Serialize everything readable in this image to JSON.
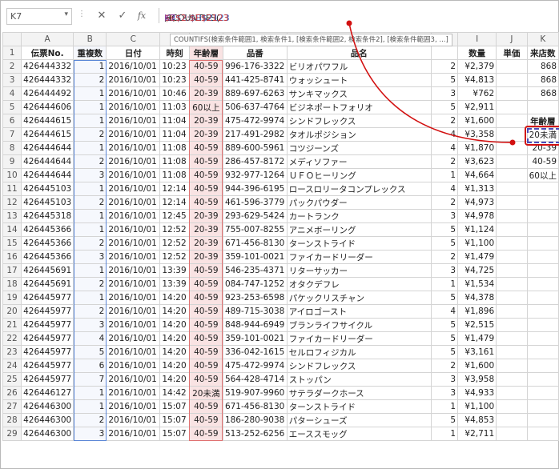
{
  "formula_bar": {
    "name_box": "K7",
    "formula_prefix": "=COUNTIFS(",
    "formula_arg1": "$B$2:$B$2123",
    "formula_arg2": ",1,",
    "formula_arg3": "$E$2:$E$2123",
    "formula_arg4": ",",
    "formula_arg5": "K7",
    "tooltip": "COUNTIFS(検索条件範囲1, 検索条件1, [検索条件範囲2, 検索条件2], [検索条件範囲3, ...]"
  },
  "columns": [
    "A",
    "B",
    "C",
    "D",
    "E",
    "F",
    "G",
    "H",
    "I",
    "J",
    "K"
  ],
  "headers": [
    "伝票No.",
    "重複数",
    "日付",
    "時刻",
    "年齢層",
    "品番",
    "品名",
    "",
    "数量",
    "単価",
    "来店数"
  ],
  "rows": [
    [
      "426444332",
      "1",
      "2016/10/01",
      "10:23",
      "40-59",
      "996-176-3322",
      "ビリオパワフル",
      "2",
      "¥2,379",
      "",
      "868"
    ],
    [
      "426444332",
      "2",
      "2016/10/01",
      "10:23",
      "40-59",
      "441-425-8741",
      "ウォッシュート",
      "5",
      "¥4,813",
      "",
      "868"
    ],
    [
      "426444492",
      "1",
      "2016/10/01",
      "10:46",
      "20-39",
      "889-697-6263",
      "サンキマックス",
      "3",
      "¥762",
      "",
      "868"
    ],
    [
      "426444606",
      "1",
      "2016/10/01",
      "11:03",
      "60以上",
      "506-637-4764",
      "ビジネポートフォリオ",
      "5",
      "¥2,911",
      "",
      ""
    ],
    [
      "426444615",
      "1",
      "2016/10/01",
      "11:04",
      "20-39",
      "475-472-9974",
      "シンドフレックス",
      "2",
      "¥1,600",
      "",
      "年齢層"
    ],
    [
      "426444615",
      "2",
      "2016/10/01",
      "11:04",
      "20-39",
      "217-491-2982",
      "タオルポジション",
      "4",
      "¥3,358",
      "",
      "20未満"
    ],
    [
      "426444644",
      "1",
      "2016/10/01",
      "11:08",
      "40-59",
      "889-600-5961",
      "コツジーンズ",
      "4",
      "¥1,870",
      "",
      "20-39"
    ],
    [
      "426444644",
      "2",
      "2016/10/01",
      "11:08",
      "40-59",
      "286-457-8172",
      "メディソファー",
      "2",
      "¥3,623",
      "",
      "40-59"
    ],
    [
      "426444644",
      "3",
      "2016/10/01",
      "11:08",
      "40-59",
      "932-977-1264",
      "ＵＦＯヒーリング",
      "1",
      "¥4,664",
      "",
      "60以上"
    ],
    [
      "426445103",
      "1",
      "2016/10/01",
      "12:14",
      "40-59",
      "944-396-6195",
      "ロースロリータコンプレックス",
      "4",
      "¥1,313",
      "",
      ""
    ],
    [
      "426445103",
      "2",
      "2016/10/01",
      "12:14",
      "40-59",
      "461-596-3779",
      "パックパウダー",
      "2",
      "¥4,973",
      "",
      ""
    ],
    [
      "426445318",
      "1",
      "2016/10/01",
      "12:45",
      "20-39",
      "293-629-5424",
      "カートランク",
      "3",
      "¥4,978",
      "",
      ""
    ],
    [
      "426445366",
      "1",
      "2016/10/01",
      "12:52",
      "20-39",
      "755-007-8255",
      "アニメボーリング",
      "5",
      "¥1,124",
      "",
      ""
    ],
    [
      "426445366",
      "2",
      "2016/10/01",
      "12:52",
      "20-39",
      "671-456-8130",
      "ターンストライド",
      "5",
      "¥1,100",
      "",
      ""
    ],
    [
      "426445366",
      "3",
      "2016/10/01",
      "12:52",
      "20-39",
      "359-101-0021",
      "ファイカードリーダー",
      "2",
      "¥1,479",
      "",
      ""
    ],
    [
      "426445691",
      "1",
      "2016/10/01",
      "13:39",
      "40-59",
      "546-235-4371",
      "リターサッカー",
      "3",
      "¥4,725",
      "",
      ""
    ],
    [
      "426445691",
      "2",
      "2016/10/01",
      "13:39",
      "40-59",
      "084-747-1252",
      "オタクデフレ",
      "1",
      "¥1,534",
      "",
      ""
    ],
    [
      "426445977",
      "1",
      "2016/10/01",
      "14:20",
      "40-59",
      "923-253-6598",
      "パケックリスチャン",
      "5",
      "¥4,378",
      "",
      ""
    ],
    [
      "426445977",
      "2",
      "2016/10/01",
      "14:20",
      "40-59",
      "489-715-3038",
      "アイロゴースト",
      "4",
      "¥1,896",
      "",
      ""
    ],
    [
      "426445977",
      "3",
      "2016/10/01",
      "14:20",
      "40-59",
      "848-944-6949",
      "ブランライフサイクル",
      "5",
      "¥2,515",
      "",
      ""
    ],
    [
      "426445977",
      "4",
      "2016/10/01",
      "14:20",
      "40-59",
      "359-101-0021",
      "ファイカードリーダー",
      "5",
      "¥1,479",
      "",
      ""
    ],
    [
      "426445977",
      "5",
      "2016/10/01",
      "14:20",
      "40-59",
      "336-042-1615",
      "セルロフィジカル",
      "5",
      "¥3,161",
      "",
      ""
    ],
    [
      "426445977",
      "6",
      "2016/10/01",
      "14:20",
      "40-59",
      "475-472-9974",
      "シンドフレックス",
      "2",
      "¥1,600",
      "",
      ""
    ],
    [
      "426445977",
      "7",
      "2016/10/01",
      "14:20",
      "40-59",
      "564-428-4714",
      "ストッパン",
      "3",
      "¥3,958",
      "",
      ""
    ],
    [
      "426446127",
      "1",
      "2016/10/01",
      "14:42",
      "20未満",
      "519-907-9960",
      "サテラダークホース",
      "3",
      "¥4,933",
      "",
      ""
    ],
    [
      "426446300",
      "1",
      "2016/10/01",
      "15:07",
      "40-59",
      "671-456-8130",
      "ターンストライド",
      "1",
      "¥1,100",
      "",
      ""
    ],
    [
      "426446300",
      "2",
      "2016/10/01",
      "15:07",
      "40-59",
      "186-280-9038",
      "パターシューズ",
      "5",
      "¥4,853",
      "",
      ""
    ],
    [
      "426446300",
      "3",
      "2016/10/01",
      "15:07",
      "40-59",
      "513-252-6256",
      "エーススモッグ",
      "1",
      "¥2,711",
      "",
      ""
    ]
  ],
  "colors": {
    "range_b": "#5a86d6",
    "range_e": "#e07070",
    "callout": "#d21010",
    "selection": "#4a4ab8"
  }
}
